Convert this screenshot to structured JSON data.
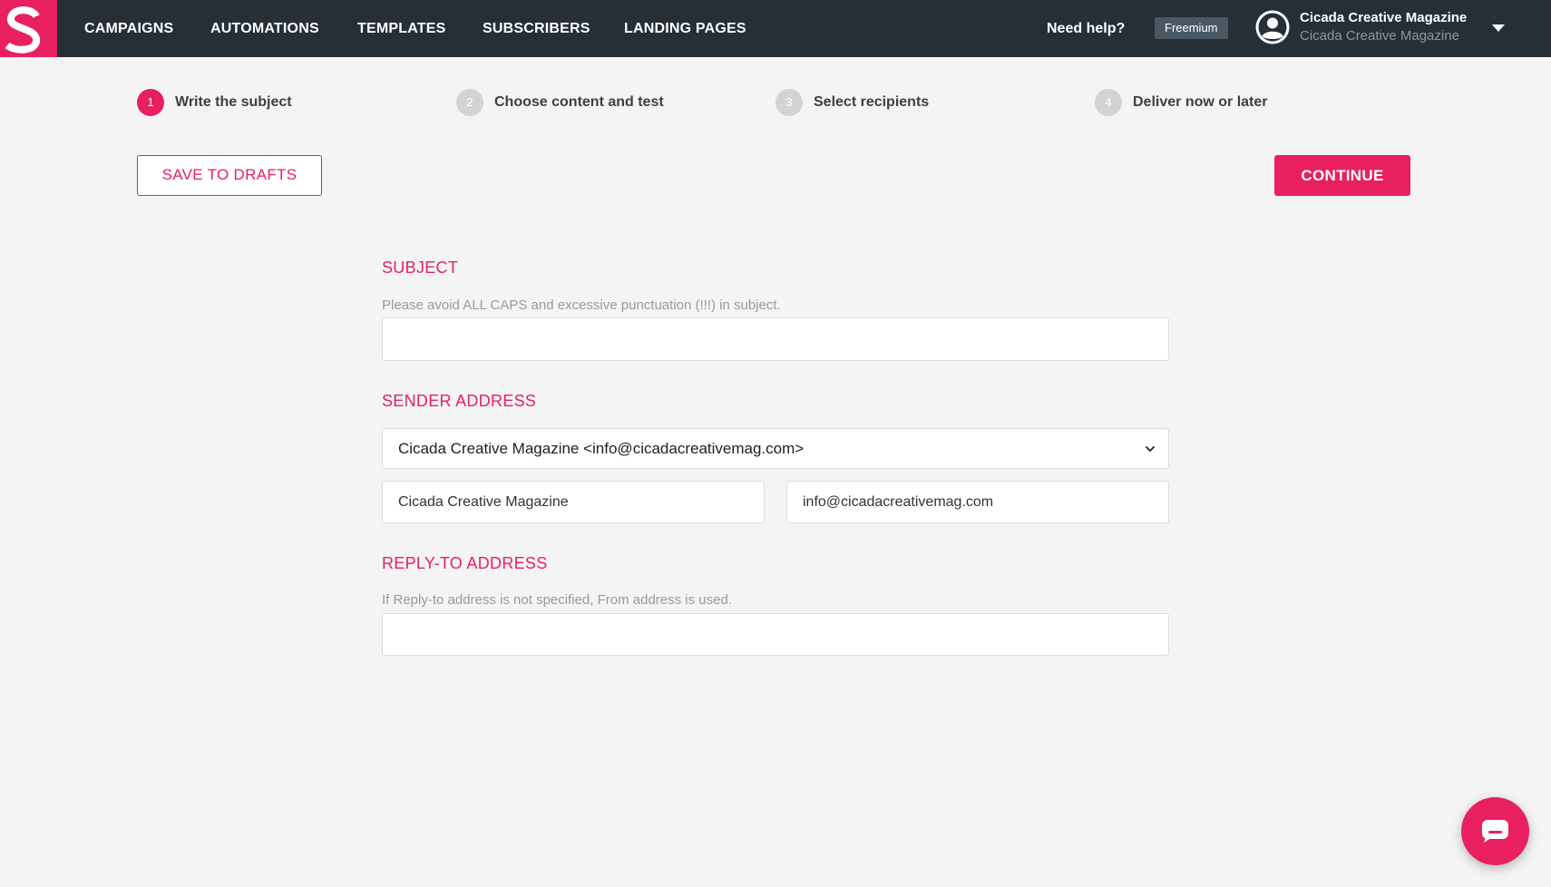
{
  "brand": {
    "logo_letter": "S",
    "accent_color": "#e8205f",
    "nav_bg": "#262f36"
  },
  "nav": {
    "items": [
      "CAMPAIGNS",
      "AUTOMATIONS",
      "TEMPLATES",
      "SUBSCRIBERS",
      "LANDING PAGES"
    ],
    "help": "Need help?",
    "plan": "Freemium",
    "account": {
      "name": "Cicada Creative Magazine",
      "sub": "Cicada Creative Magazine",
      "avatar_icon": "user-circle-icon"
    }
  },
  "steps": [
    {
      "number": "1",
      "label": "Write the subject",
      "active": true
    },
    {
      "number": "2",
      "label": "Choose content and test",
      "active": false
    },
    {
      "number": "3",
      "label": "Select recipients",
      "active": false
    },
    {
      "number": "4",
      "label": "Deliver now or later",
      "active": false
    }
  ],
  "actions": {
    "save_drafts": "SAVE TO DRAFTS",
    "continue": "CONTINUE"
  },
  "form": {
    "subject": {
      "title": "SUBJECT",
      "hint": "Please avoid ALL CAPS and excessive punctuation (!!!) in subject.",
      "value": ""
    },
    "sender": {
      "title": "SENDER ADDRESS",
      "selected": "Cicada Creative Magazine <info@cicadacreativemag.com>",
      "name_value": "Cicada Creative Magazine",
      "email_value": "info@cicadacreativemag.com"
    },
    "reply_to": {
      "title": "REPLY-TO ADDRESS",
      "hint": "If Reply-to address is not specified, From address is used.",
      "value": ""
    }
  },
  "chat": {
    "icon": "chat-bubble-icon"
  }
}
